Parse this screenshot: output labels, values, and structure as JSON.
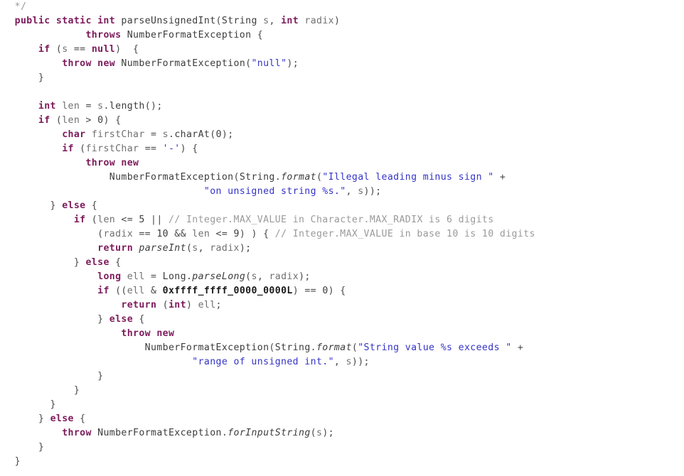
{
  "document": {
    "kind": "source-code-listing",
    "language": "Java",
    "background_color": "#ffffff",
    "line_height_px": 20,
    "font_size_px": 13.2
  },
  "palette": {
    "keyword": "#7d1b5b",
    "string": "#3434c8",
    "comment": "#9a9a9a",
    "type": "#3c3c3c",
    "identifier": "#707070",
    "number_bold": "#1a1a1a",
    "method_italic": "#3c3c3c",
    "punctuation": "#4a4a4a",
    "background": "#ffffff"
  },
  "code": {
    "lines": [
      {
        "index": 0,
        "tokens": [
          {
            "t": "  ",
            "c": "pun"
          },
          {
            "t": "*/",
            "c": "cmt"
          }
        ]
      },
      {
        "index": 1,
        "tokens": [
          {
            "t": "  ",
            "c": "pun"
          },
          {
            "t": "public static int",
            "c": "kw"
          },
          {
            "t": " ",
            "c": "pun"
          },
          {
            "t": "parseUnsignedInt",
            "c": "typ"
          },
          {
            "t": "(",
            "c": "pun"
          },
          {
            "t": "String",
            "c": "typ"
          },
          {
            "t": " ",
            "c": "pun"
          },
          {
            "t": "s",
            "c": "id"
          },
          {
            "t": ", ",
            "c": "pun"
          },
          {
            "t": "int",
            "c": "kw"
          },
          {
            "t": " ",
            "c": "pun"
          },
          {
            "t": "radix",
            "c": "id"
          },
          {
            "t": ")",
            "c": "pun"
          }
        ]
      },
      {
        "index": 2,
        "tokens": [
          {
            "t": "              ",
            "c": "pun"
          },
          {
            "t": "throws",
            "c": "kw"
          },
          {
            "t": " ",
            "c": "pun"
          },
          {
            "t": "NumberFormatException",
            "c": "typ"
          },
          {
            "t": " {",
            "c": "pun"
          }
        ]
      },
      {
        "index": 3,
        "tokens": [
          {
            "t": "      ",
            "c": "pun"
          },
          {
            "t": "if",
            "c": "kw"
          },
          {
            "t": " (",
            "c": "pun"
          },
          {
            "t": "s",
            "c": "id"
          },
          {
            "t": " == ",
            "c": "pun"
          },
          {
            "t": "null",
            "c": "kw"
          },
          {
            "t": ")  {",
            "c": "pun"
          }
        ]
      },
      {
        "index": 4,
        "tokens": [
          {
            "t": "          ",
            "c": "pun"
          },
          {
            "t": "throw new",
            "c": "kw"
          },
          {
            "t": " ",
            "c": "pun"
          },
          {
            "t": "NumberFormatException",
            "c": "typ"
          },
          {
            "t": "(",
            "c": "pun"
          },
          {
            "t": "\"null\"",
            "c": "str"
          },
          {
            "t": ");",
            "c": "pun"
          }
        ]
      },
      {
        "index": 5,
        "tokens": [
          {
            "t": "      }",
            "c": "pun"
          }
        ]
      },
      {
        "index": 6,
        "tokens": [
          {
            "t": "",
            "c": "pun"
          }
        ]
      },
      {
        "index": 7,
        "tokens": [
          {
            "t": "      ",
            "c": "pun"
          },
          {
            "t": "int",
            "c": "kw"
          },
          {
            "t": " ",
            "c": "pun"
          },
          {
            "t": "len",
            "c": "id"
          },
          {
            "t": " = ",
            "c": "pun"
          },
          {
            "t": "s",
            "c": "id"
          },
          {
            "t": ".",
            "c": "pun"
          },
          {
            "t": "length",
            "c": "typ"
          },
          {
            "t": "();",
            "c": "pun"
          }
        ]
      },
      {
        "index": 8,
        "tokens": [
          {
            "t": "      ",
            "c": "pun"
          },
          {
            "t": "if",
            "c": "kw"
          },
          {
            "t": " (",
            "c": "pun"
          },
          {
            "t": "len",
            "c": "id"
          },
          {
            "t": " > ",
            "c": "pun"
          },
          {
            "t": "0",
            "c": "num"
          },
          {
            "t": ") {",
            "c": "pun"
          }
        ]
      },
      {
        "index": 9,
        "tokens": [
          {
            "t": "          ",
            "c": "pun"
          },
          {
            "t": "char",
            "c": "kw"
          },
          {
            "t": " ",
            "c": "pun"
          },
          {
            "t": "firstChar",
            "c": "id"
          },
          {
            "t": " = ",
            "c": "pun"
          },
          {
            "t": "s",
            "c": "id"
          },
          {
            "t": ".",
            "c": "pun"
          },
          {
            "t": "charAt",
            "c": "typ"
          },
          {
            "t": "(",
            "c": "pun"
          },
          {
            "t": "0",
            "c": "num"
          },
          {
            "t": ");",
            "c": "pun"
          }
        ]
      },
      {
        "index": 10,
        "tokens": [
          {
            "t": "          ",
            "c": "pun"
          },
          {
            "t": "if",
            "c": "kw"
          },
          {
            "t": " (",
            "c": "pun"
          },
          {
            "t": "firstChar",
            "c": "id"
          },
          {
            "t": " == ",
            "c": "pun"
          },
          {
            "t": "'-'",
            "c": "str"
          },
          {
            "t": ") {",
            "c": "pun"
          }
        ]
      },
      {
        "index": 11,
        "tokens": [
          {
            "t": "              ",
            "c": "pun"
          },
          {
            "t": "throw new",
            "c": "kw"
          }
        ]
      },
      {
        "index": 12,
        "tokens": [
          {
            "t": "                  ",
            "c": "pun"
          },
          {
            "t": "NumberFormatException",
            "c": "typ"
          },
          {
            "t": "(",
            "c": "pun"
          },
          {
            "t": "String",
            "c": "typ"
          },
          {
            "t": ".",
            "c": "pun"
          },
          {
            "t": "format",
            "c": "mth"
          },
          {
            "t": "(",
            "c": "pun"
          },
          {
            "t": "\"Illegal leading minus sign \"",
            "c": "str"
          },
          {
            "t": " +",
            "c": "pun"
          }
        ]
      },
      {
        "index": 13,
        "tokens": [
          {
            "t": "                                  ",
            "c": "pun"
          },
          {
            "t": "\"on unsigned string %s.\"",
            "c": "str"
          },
          {
            "t": ", ",
            "c": "pun"
          },
          {
            "t": "s",
            "c": "id"
          },
          {
            "t": "));",
            "c": "pun"
          }
        ]
      },
      {
        "index": 14,
        "tokens": [
          {
            "t": "        } ",
            "c": "pun"
          },
          {
            "t": "else",
            "c": "kw"
          },
          {
            "t": " {",
            "c": "pun"
          }
        ]
      },
      {
        "index": 15,
        "tokens": [
          {
            "t": "            ",
            "c": "pun"
          },
          {
            "t": "if",
            "c": "kw"
          },
          {
            "t": " (",
            "c": "pun"
          },
          {
            "t": "len",
            "c": "id"
          },
          {
            "t": " <= ",
            "c": "pun"
          },
          {
            "t": "5",
            "c": "num"
          },
          {
            "t": " || ",
            "c": "pun"
          },
          {
            "t": "// Integer.MAX_VALUE in Character.MAX_RADIX is 6 digits",
            "c": "cmt"
          }
        ]
      },
      {
        "index": 16,
        "tokens": [
          {
            "t": "                (",
            "c": "pun"
          },
          {
            "t": "radix",
            "c": "id"
          },
          {
            "t": " == ",
            "c": "pun"
          },
          {
            "t": "10",
            "c": "num"
          },
          {
            "t": " && ",
            "c": "pun"
          },
          {
            "t": "len",
            "c": "id"
          },
          {
            "t": " <= ",
            "c": "pun"
          },
          {
            "t": "9",
            "c": "num"
          },
          {
            "t": ") ) { ",
            "c": "pun"
          },
          {
            "t": "// Integer.MAX_VALUE in base 10 is 10 digits",
            "c": "cmt"
          }
        ]
      },
      {
        "index": 17,
        "tokens": [
          {
            "t": "                ",
            "c": "pun"
          },
          {
            "t": "return",
            "c": "kw"
          },
          {
            "t": " ",
            "c": "pun"
          },
          {
            "t": "parseInt",
            "c": "mth"
          },
          {
            "t": "(",
            "c": "pun"
          },
          {
            "t": "s",
            "c": "id"
          },
          {
            "t": ", ",
            "c": "pun"
          },
          {
            "t": "radix",
            "c": "id"
          },
          {
            "t": ");",
            "c": "pun"
          }
        ]
      },
      {
        "index": 18,
        "tokens": [
          {
            "t": "            } ",
            "c": "pun"
          },
          {
            "t": "else",
            "c": "kw"
          },
          {
            "t": " {",
            "c": "pun"
          }
        ]
      },
      {
        "index": 19,
        "tokens": [
          {
            "t": "                ",
            "c": "pun"
          },
          {
            "t": "long",
            "c": "kw"
          },
          {
            "t": " ",
            "c": "pun"
          },
          {
            "t": "ell",
            "c": "id"
          },
          {
            "t": " = ",
            "c": "pun"
          },
          {
            "t": "Long",
            "c": "typ"
          },
          {
            "t": ".",
            "c": "pun"
          },
          {
            "t": "parseLong",
            "c": "mth"
          },
          {
            "t": "(",
            "c": "pun"
          },
          {
            "t": "s",
            "c": "id"
          },
          {
            "t": ", ",
            "c": "pun"
          },
          {
            "t": "radix",
            "c": "id"
          },
          {
            "t": ");",
            "c": "pun"
          }
        ]
      },
      {
        "index": 20,
        "tokens": [
          {
            "t": "                ",
            "c": "pun"
          },
          {
            "t": "if",
            "c": "kw"
          },
          {
            "t": " ((",
            "c": "pun"
          },
          {
            "t": "ell",
            "c": "id"
          },
          {
            "t": " & ",
            "c": "pun"
          },
          {
            "t": "0xffff_ffff_0000_0000L",
            "c": "numb"
          },
          {
            "t": ") == ",
            "c": "pun"
          },
          {
            "t": "0",
            "c": "num"
          },
          {
            "t": ") {",
            "c": "pun"
          }
        ]
      },
      {
        "index": 21,
        "tokens": [
          {
            "t": "                    ",
            "c": "pun"
          },
          {
            "t": "return",
            "c": "kw"
          },
          {
            "t": " (",
            "c": "pun"
          },
          {
            "t": "int",
            "c": "kw"
          },
          {
            "t": ") ",
            "c": "pun"
          },
          {
            "t": "ell",
            "c": "id"
          },
          {
            "t": ";",
            "c": "pun"
          }
        ]
      },
      {
        "index": 22,
        "tokens": [
          {
            "t": "                } ",
            "c": "pun"
          },
          {
            "t": "else",
            "c": "kw"
          },
          {
            "t": " {",
            "c": "pun"
          }
        ]
      },
      {
        "index": 23,
        "tokens": [
          {
            "t": "                    ",
            "c": "pun"
          },
          {
            "t": "throw new",
            "c": "kw"
          }
        ]
      },
      {
        "index": 24,
        "tokens": [
          {
            "t": "                        ",
            "c": "pun"
          },
          {
            "t": "NumberFormatException",
            "c": "typ"
          },
          {
            "t": "(",
            "c": "pun"
          },
          {
            "t": "String",
            "c": "typ"
          },
          {
            "t": ".",
            "c": "pun"
          },
          {
            "t": "format",
            "c": "mth"
          },
          {
            "t": "(",
            "c": "pun"
          },
          {
            "t": "\"String value %s exceeds \"",
            "c": "str"
          },
          {
            "t": " +",
            "c": "pun"
          }
        ]
      },
      {
        "index": 25,
        "tokens": [
          {
            "t": "                                ",
            "c": "pun"
          },
          {
            "t": "\"range of unsigned int.\"",
            "c": "str"
          },
          {
            "t": ", ",
            "c": "pun"
          },
          {
            "t": "s",
            "c": "id"
          },
          {
            "t": "));",
            "c": "pun"
          }
        ]
      },
      {
        "index": 26,
        "tokens": [
          {
            "t": "                }",
            "c": "pun"
          }
        ]
      },
      {
        "index": 27,
        "tokens": [
          {
            "t": "            }",
            "c": "pun"
          }
        ]
      },
      {
        "index": 28,
        "tokens": [
          {
            "t": "        }",
            "c": "pun"
          }
        ]
      },
      {
        "index": 29,
        "tokens": [
          {
            "t": "      } ",
            "c": "pun"
          },
          {
            "t": "else",
            "c": "kw"
          },
          {
            "t": " {",
            "c": "pun"
          }
        ]
      },
      {
        "index": 30,
        "tokens": [
          {
            "t": "          ",
            "c": "pun"
          },
          {
            "t": "throw",
            "c": "kw"
          },
          {
            "t": " ",
            "c": "pun"
          },
          {
            "t": "NumberFormatException",
            "c": "typ"
          },
          {
            "t": ".",
            "c": "pun"
          },
          {
            "t": "forInputString",
            "c": "mth"
          },
          {
            "t": "(",
            "c": "pun"
          },
          {
            "t": "s",
            "c": "id"
          },
          {
            "t": ");",
            "c": "pun"
          }
        ]
      },
      {
        "index": 31,
        "tokens": [
          {
            "t": "      }",
            "c": "pun"
          }
        ]
      },
      {
        "index": 32,
        "tokens": [
          {
            "t": "  }",
            "c": "pun"
          }
        ]
      }
    ],
    "plain_text": [
      "  */",
      "  public static int parseUnsignedInt(String s, int radix)",
      "              throws NumberFormatException {",
      "      if (s == null)  {",
      "          throw new NumberFormatException(\"null\");",
      "      }",
      "",
      "      int len = s.length();",
      "      if (len > 0) {",
      "          char firstChar = s.charAt(0);",
      "          if (firstChar == '-') {",
      "              throw new",
      "                  NumberFormatException(String.format(\"Illegal leading minus sign \" +",
      "                                  \"on unsigned string %s.\", s));",
      "        } else {",
      "            if (len <= 5 || // Integer.MAX_VALUE in Character.MAX_RADIX is 6 digits",
      "                (radix == 10 && len <= 9) ) { // Integer.MAX_VALUE in base 10 is 10 digits",
      "                return parseInt(s, radix);",
      "            } else {",
      "                long ell = Long.parseLong(s, radix);",
      "                if ((ell & 0xffff_ffff_0000_0000L) == 0) {",
      "                    return (int) ell;",
      "                } else {",
      "                    throw new",
      "                        NumberFormatException(String.format(\"String value %s exceeds \" +",
      "                                \"range of unsigned int.\", s));",
      "                }",
      "            }",
      "        }",
      "      } else {",
      "          throw NumberFormatException.forInputString(s);",
      "      }",
      "  }"
    ]
  }
}
